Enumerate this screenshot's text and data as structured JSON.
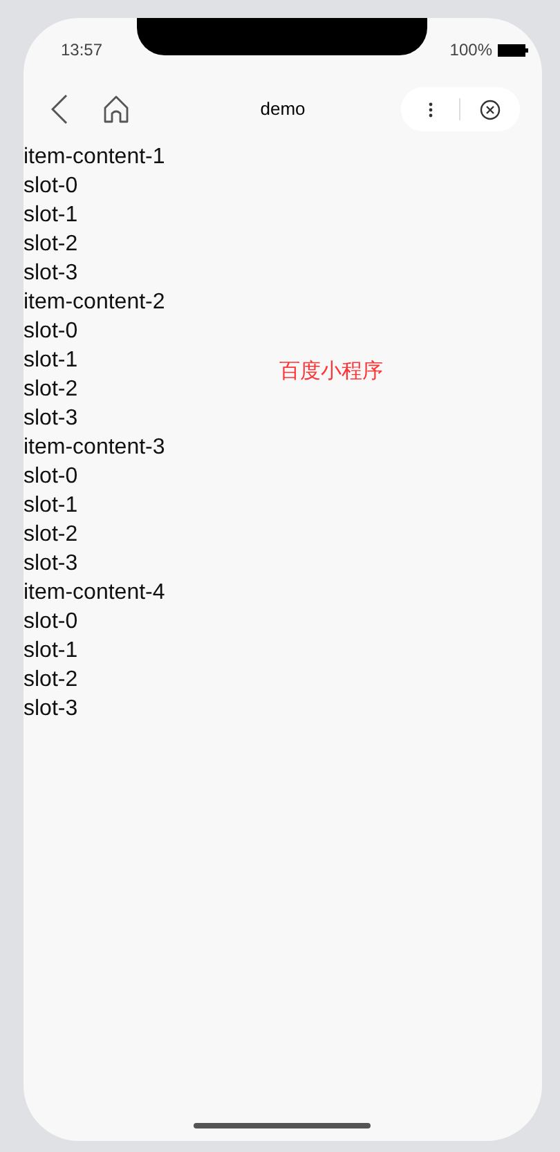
{
  "status_bar": {
    "time": "13:57",
    "battery_text": "100%"
  },
  "nav_bar": {
    "title": "demo"
  },
  "items": [
    {
      "title": "item-content-1",
      "slots": [
        "slot-0",
        "slot-1",
        "slot-2",
        "slot-3"
      ]
    },
    {
      "title": "item-content-2",
      "slots": [
        "slot-0",
        "slot-1",
        "slot-2",
        "slot-3"
      ]
    },
    {
      "title": "item-content-3",
      "slots": [
        "slot-0",
        "slot-1",
        "slot-2",
        "slot-3"
      ]
    },
    {
      "title": "item-content-4",
      "slots": [
        "slot-0",
        "slot-1",
        "slot-2",
        "slot-3"
      ]
    }
  ],
  "overlay_label": "百度小程序"
}
